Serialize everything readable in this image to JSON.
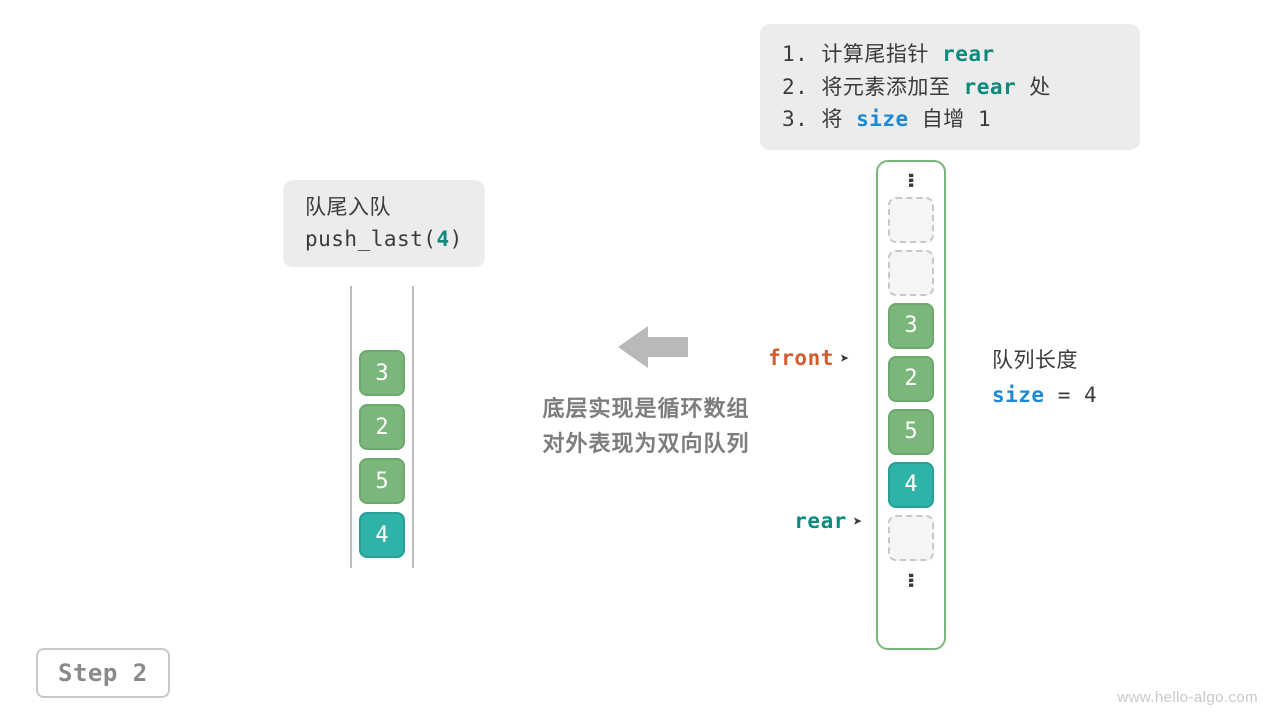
{
  "steps_box": {
    "line1_pre": "1. 计算尾指针 ",
    "line1_kw": "rear",
    "line2_pre": "2. 将元素添加至 ",
    "line2_kw": "rear",
    "line2_post": " 处",
    "line3_pre": "3. 将 ",
    "line3_kw": "size",
    "line3_post": " 自增 1"
  },
  "push_box": {
    "title": "队尾入队",
    "call_pre": "push_last(",
    "call_arg": "4",
    "call_post": ")"
  },
  "deque_values": [
    "3",
    "2",
    "5",
    "4"
  ],
  "center_text": {
    "line1": "底层实现是循环数组",
    "line2": "对外表现为双向队列"
  },
  "ring": {
    "slots": [
      {
        "type": "dashed"
      },
      {
        "type": "dashed"
      },
      {
        "type": "green",
        "value": "3",
        "ptr": "front"
      },
      {
        "type": "green",
        "value": "2"
      },
      {
        "type": "green",
        "value": "5"
      },
      {
        "type": "teal",
        "value": "4",
        "ptr": "rear"
      },
      {
        "type": "dashed"
      }
    ]
  },
  "ptr_labels": {
    "front": "front",
    "rear": "rear"
  },
  "size_info": {
    "label": "队列长度",
    "kw": "size",
    "eq": " = ",
    "value": "4"
  },
  "step_tag": "Step 2",
  "watermark": "www.hello-algo.com",
  "colors": {
    "green": "#7bb77a",
    "teal": "#2fb3a8",
    "front": "#d35c2c",
    "rear": "#0c8a7d",
    "size": "#1e88d2"
  }
}
